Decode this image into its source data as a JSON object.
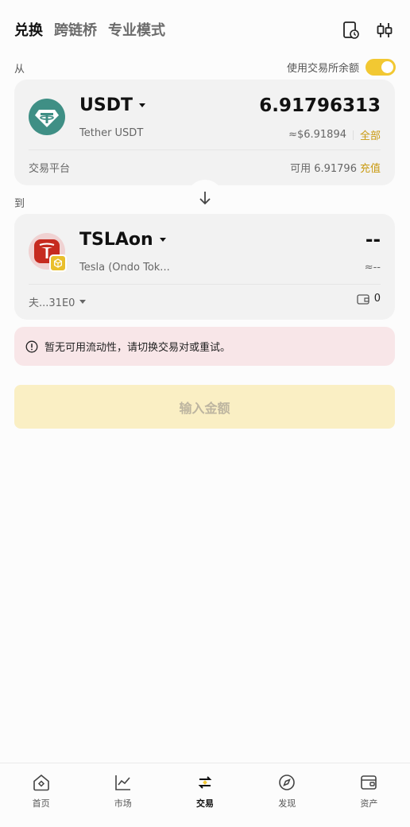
{
  "tabs": [
    {
      "label": "兑换"
    },
    {
      "label": "跨链桥"
    },
    {
      "label": "专业模式"
    }
  ],
  "from": {
    "section_label": "从",
    "use_balance_label": "使用交易所余额",
    "symbol": "USDT",
    "name": "Tether USDT",
    "amount": "6.91796313",
    "usd_value": "≈$6.91894",
    "max_label": "全部",
    "source": "交易平台",
    "available": "可用 6.91796",
    "deposit_label": "充值"
  },
  "to": {
    "section_label": "到",
    "symbol": "TSLAon",
    "name": "Tesla (Ondo Tok...",
    "amount": "--",
    "usd_value": "≈--",
    "account": "夫...31E0",
    "wallet_balance": "0"
  },
  "warning": {
    "text": "暂无可用流动性，请切换交易对或重试。"
  },
  "main_button": {
    "label": "输入金额"
  },
  "bottom_nav": [
    {
      "label": "首页",
      "icon": "home-icon"
    },
    {
      "label": "市场",
      "icon": "market-icon"
    },
    {
      "label": "交易",
      "icon": "trade-icon"
    },
    {
      "label": "发现",
      "icon": "discover-icon"
    },
    {
      "label": "资产",
      "icon": "assets-icon"
    }
  ],
  "colors": {
    "accent": "#f2c832",
    "gold_text": "#c99a10",
    "usdt_green": "#3f8f85",
    "tesla_red": "#c62a1f"
  }
}
